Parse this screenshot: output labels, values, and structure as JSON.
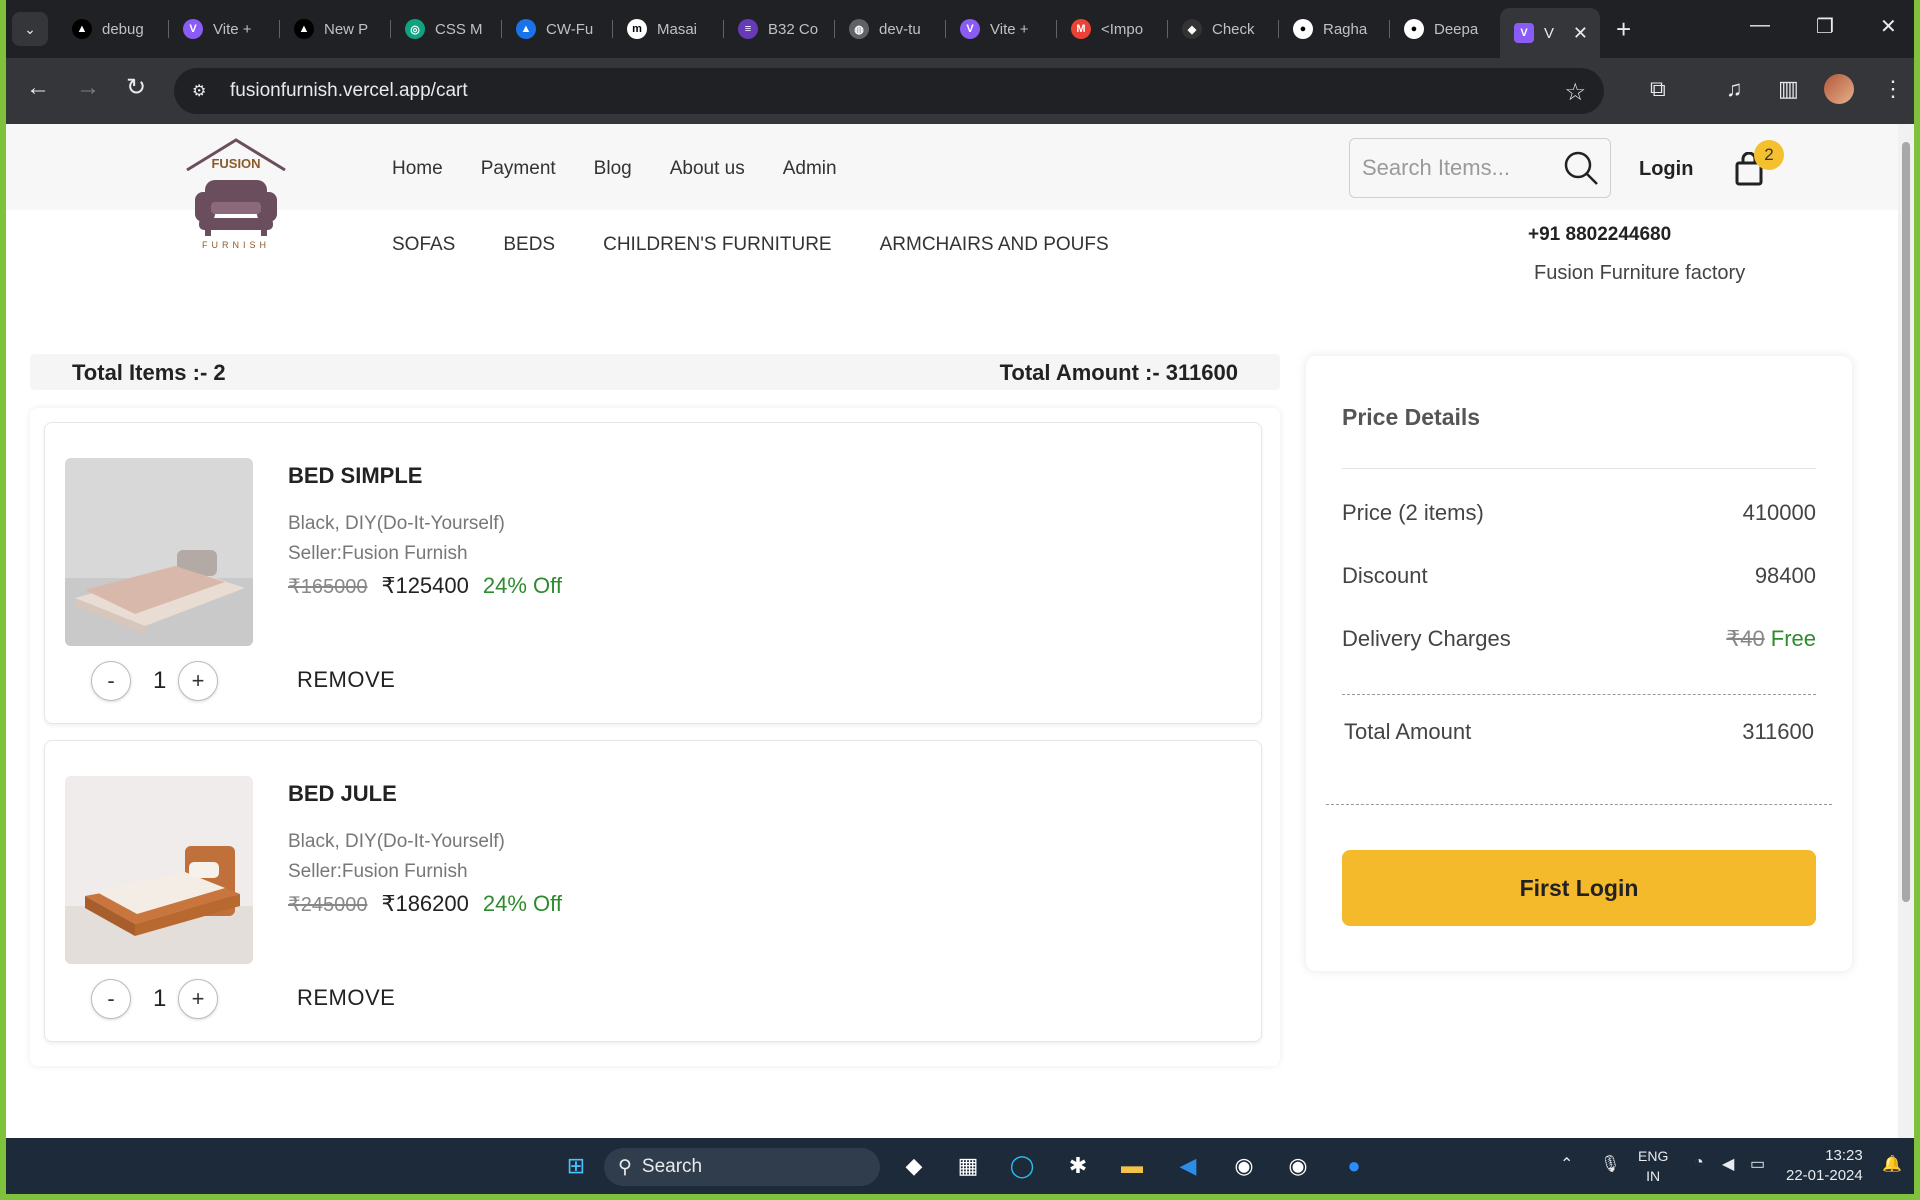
{
  "browser": {
    "tabs": [
      {
        "label": "debug",
        "fav": "▲",
        "favbg": "#000"
      },
      {
        "label": "Vite +",
        "fav": "V",
        "favbg": "#8a5cf6"
      },
      {
        "label": "New P",
        "fav": "▲",
        "favbg": "#000"
      },
      {
        "label": "CSS M",
        "fav": "◎",
        "favbg": "#10a37f"
      },
      {
        "label": "CW-Fu",
        "fav": "▲",
        "favbg": "#1a73e8"
      },
      {
        "label": "Masai",
        "fav": "m",
        "favbg": "#fff"
      },
      {
        "label": "B32 Co",
        "fav": "≡",
        "favbg": "#673ab7"
      },
      {
        "label": "dev-tu",
        "fav": "◍",
        "favbg": "#5f6368"
      },
      {
        "label": "Vite +",
        "fav": "V",
        "favbg": "#8a5cf6"
      },
      {
        "label": "<Impo",
        "fav": "M",
        "favbg": "#ea4335"
      },
      {
        "label": "Check",
        "fav": "◆",
        "favbg": "#333"
      },
      {
        "label": "Ragha",
        "fav": "●",
        "favbg": "#fff"
      },
      {
        "label": "Deepa",
        "fav": "●",
        "favbg": "#fff"
      }
    ],
    "active_tab": {
      "label": "V",
      "fav": "V"
    },
    "url": "fusionfurnish.vercel.app/cart"
  },
  "site": {
    "logo_text": "FUSION",
    "logo_sub": "FURNISH",
    "nav": [
      "Home",
      "Payment",
      "Blog",
      "About us",
      "Admin"
    ],
    "search_placeholder": "Search Items...",
    "login": "Login",
    "cart_count": "2",
    "categories": [
      "SOFAS",
      "BEDS",
      "CHILDREN'S FURNITURE",
      "ARMCHAIRS AND POUFS"
    ],
    "phone": "+91 8802244680",
    "factory": "Fusion Furniture factory"
  },
  "cart": {
    "total_items": "Total Items :- 2",
    "total_amount": "Total Amount :- 311600",
    "items": [
      {
        "name": "BED SIMPLE",
        "desc": "Black, DIY(Do-It-Yourself)",
        "seller": "Seller:Fusion Furnish",
        "old_price": "₹165000",
        "price": "₹125400",
        "off": "24% Off",
        "qty": "1",
        "remove": "REMOVE",
        "img_color": "#d9c7bd"
      },
      {
        "name": "BED JULE",
        "desc": "Black, DIY(Do-It-Yourself)",
        "seller": "Seller:Fusion Furnish",
        "old_price": "₹245000",
        "price": "₹186200",
        "off": "24% Off",
        "qty": "1",
        "remove": "REMOVE",
        "img_color": "#c0703a"
      }
    ],
    "minus": "-",
    "plus": "+"
  },
  "price_details": {
    "title": "Price Details",
    "price_label": "Price (2 items)",
    "price_value": "410000",
    "discount_label": "Discount",
    "discount_value": "98400",
    "delivery_label": "Delivery Charges",
    "delivery_old": "₹40",
    "delivery_value": "Free",
    "total_label": "Total Amount",
    "total_value": "311600",
    "button": "First Login"
  },
  "taskbar": {
    "search": "Search",
    "lang1": "ENG",
    "lang2": "IN",
    "time": "13:23",
    "date": "22-01-2024"
  }
}
